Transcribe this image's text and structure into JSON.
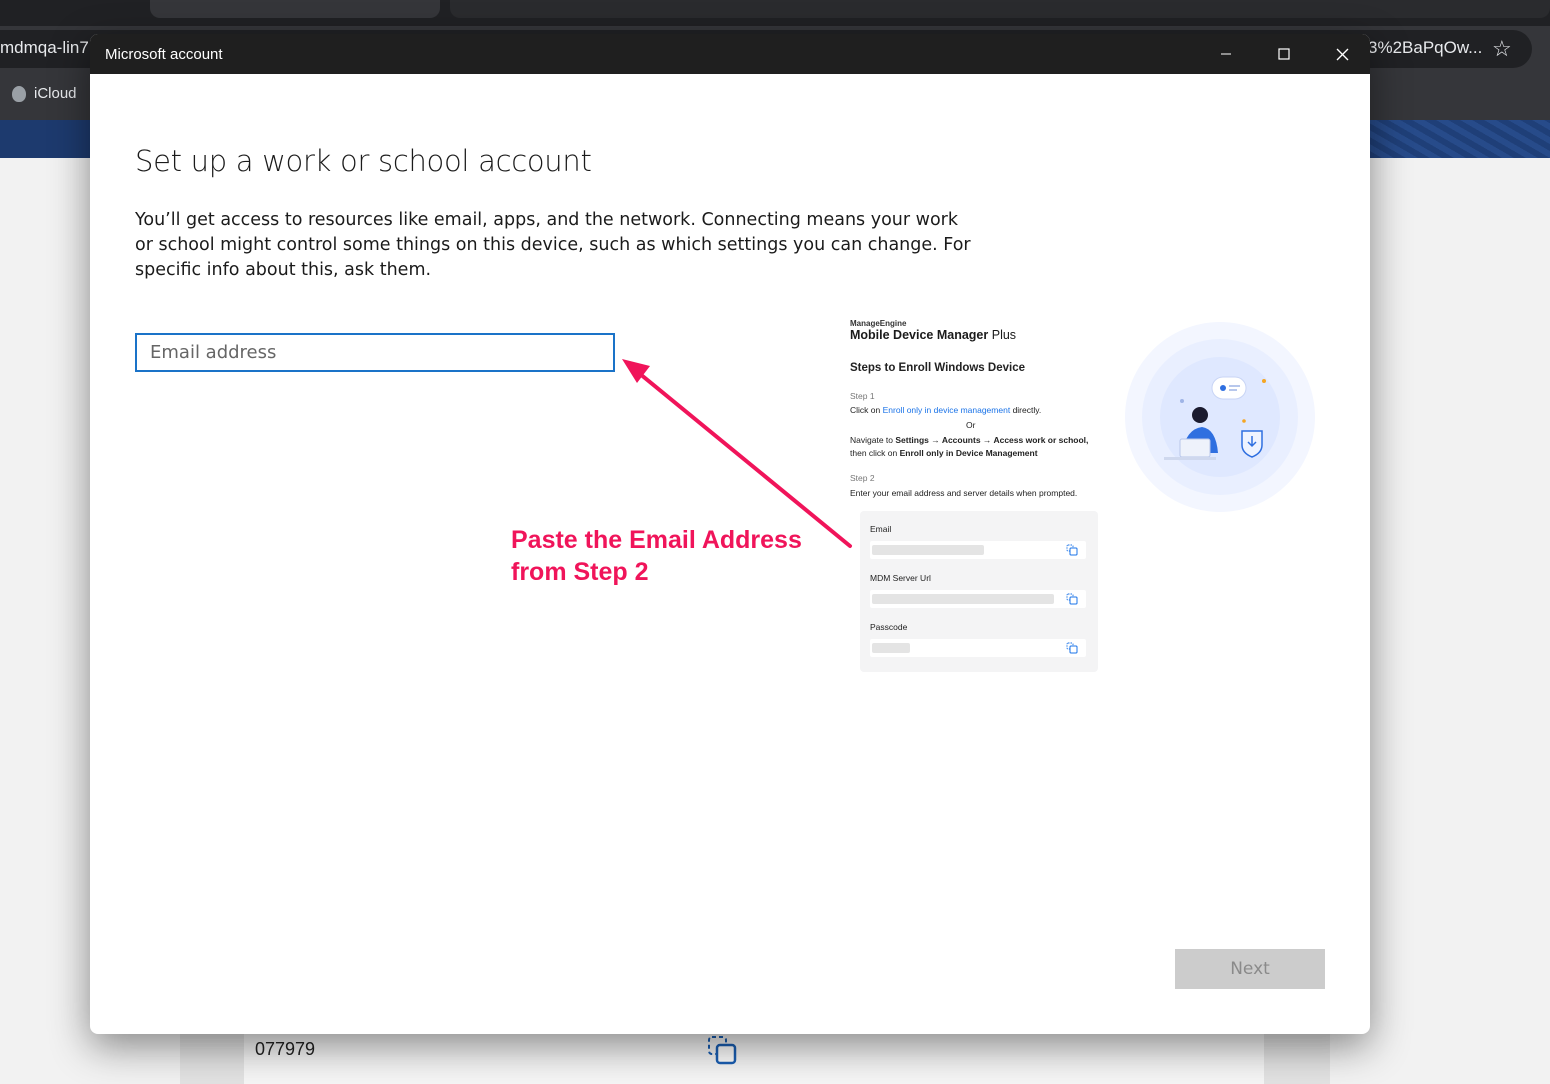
{
  "browser": {
    "url_left": "mdmqa-lin7",
    "url_right": "3%2BaPqOw...",
    "bookmark": "iCloud",
    "background_passcode": "077979"
  },
  "dialog": {
    "title": "Microsoft account",
    "heading": "Set up a work or school account",
    "description": "You’ll get access to resources like email, apps, and the network. Connecting means your work or school might control some things on this device, such as which settings you can change. For specific info about this, ask them.",
    "email_placeholder": "Email address",
    "email_value": "",
    "next_label": "Next"
  },
  "annotation": {
    "line1": "Paste the Email Address",
    "line2": "from Step 2",
    "color": "#f0145a"
  },
  "instructions_image": {
    "brand": "ManageEngine",
    "product": "Mobile Device Manager",
    "product_suffix": "Plus",
    "steps_title": "Steps to Enroll Windows Device",
    "step1_label": "Step 1",
    "step1_prefix": "Click on",
    "step1_link": "Enroll only in device management",
    "step1_suffix": "directly.",
    "or": "Or",
    "nav_line1_prefix": "Navigate to",
    "nav_line1_bold": "Settings → Accounts → Access work or school,",
    "nav_line2_prefix": "then click on",
    "nav_line2_bold": "Enroll only in Device Management",
    "step2_label": "Step 2",
    "step2_text": "Enter your email address and server details when prompted.",
    "fields": [
      {
        "label": "Email"
      },
      {
        "label": "MDM Server Url"
      },
      {
        "label": "Passcode"
      }
    ]
  },
  "icons": [
    "minimize-icon",
    "maximize-icon",
    "close-icon",
    "star-icon",
    "apple-icon",
    "copy-icon"
  ]
}
